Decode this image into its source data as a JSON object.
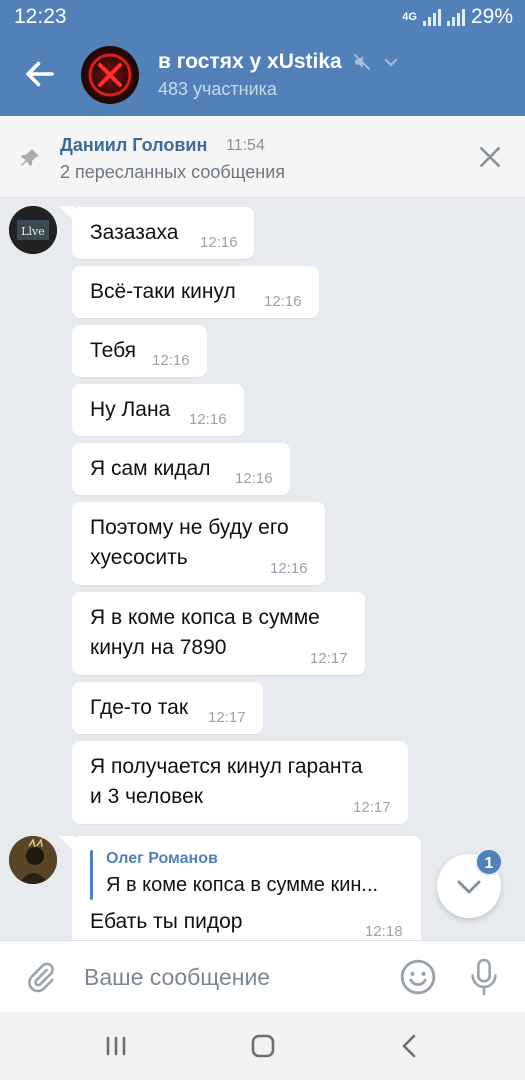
{
  "status_bar": {
    "time": "12:23",
    "network": "4G",
    "battery": "29%"
  },
  "header": {
    "title": "в гостях у xUstika",
    "subtitle": "483 участника"
  },
  "pinned": {
    "author": "Даниил Головин",
    "time": "11:54",
    "text": "2 пересланных сообщения"
  },
  "messages": [
    {
      "lines": [
        "Зазазаха"
      ],
      "time": "12:16"
    },
    {
      "lines": [
        "Всё-таки кинул"
      ],
      "time": "12:16"
    },
    {
      "lines": [
        "Тебя"
      ],
      "time": "12:16"
    },
    {
      "lines": [
        "Ну Лана"
      ],
      "time": "12:16"
    },
    {
      "lines": [
        "Я сам кидал"
      ],
      "time": "12:16"
    },
    {
      "lines": [
        "Поэтому не буду его",
        "хуесосить"
      ],
      "time": "12:16"
    },
    {
      "lines": [
        "Я в коме копса в сумме",
        "кинул на 7890"
      ],
      "time": "12:17"
    },
    {
      "lines": [
        "Где-то так"
      ],
      "time": "12:17"
    },
    {
      "lines": [
        "Я получается кинул гаранта",
        "и 3 человек"
      ],
      "time": "12:17"
    }
  ],
  "reply_message": {
    "reply_author": "Олег Романов",
    "reply_text": "Я в коме копса в сумме кин...",
    "text": "Ебать ты пидор",
    "time": "12:18"
  },
  "scroll_down": {
    "badge": "1"
  },
  "composer": {
    "placeholder": "Ваше сообщение"
  },
  "colors": {
    "brand": "#5181b8",
    "background": "#e7ebf0"
  }
}
